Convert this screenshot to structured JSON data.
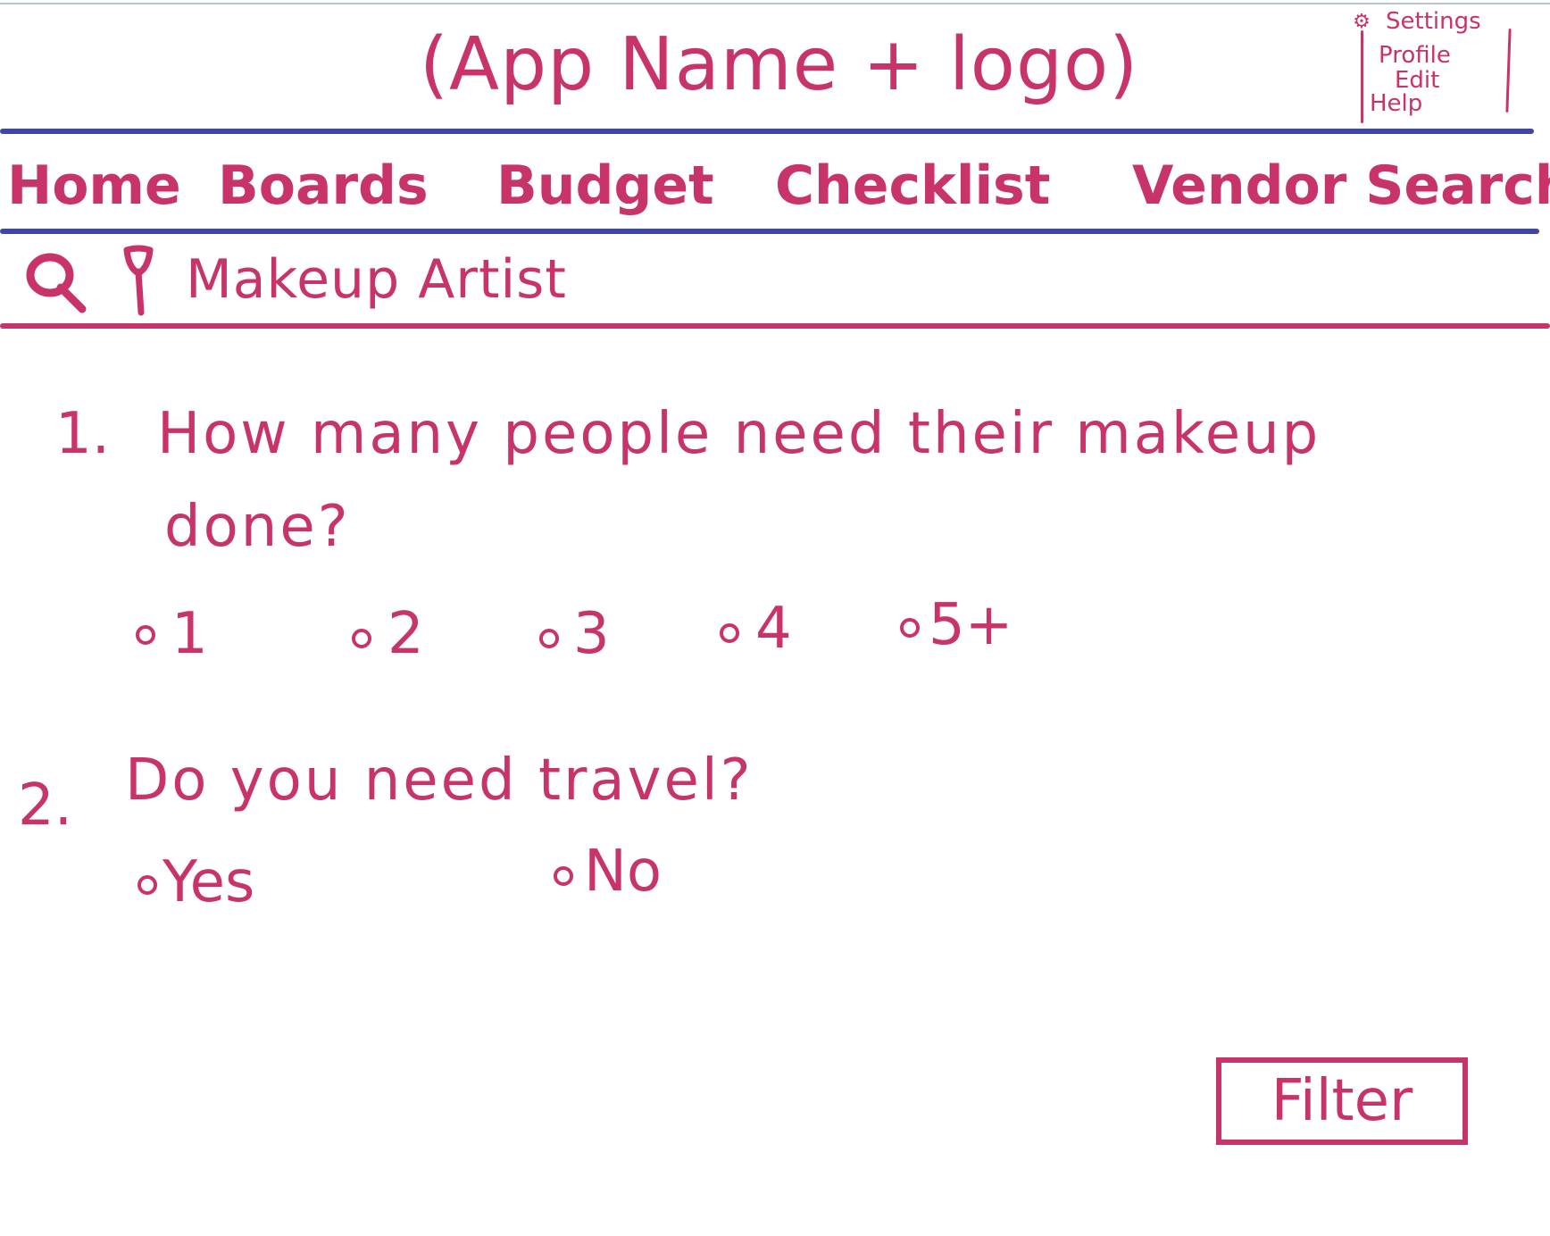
{
  "header": {
    "app_title": "(App Name + logo)",
    "settings_menu": {
      "icon": "gear-icon",
      "items": [
        "Settings",
        "Profile",
        "Edit",
        "Help"
      ]
    }
  },
  "nav": {
    "items": [
      "Home",
      "Boards",
      "Budget",
      "Checklist",
      "Vendor Search"
    ]
  },
  "search": {
    "search_icon": "search-icon",
    "location_icon": "location-pin-icon",
    "value": "Makeup Artist"
  },
  "questions": [
    {
      "number": "1.",
      "text_line1": "How many people need their makeup",
      "text_line2": "done?",
      "options": [
        "1",
        "2",
        "3",
        "4",
        "5+"
      ]
    },
    {
      "number": "2.",
      "text_line1": "Do you need travel?",
      "options": [
        "Yes",
        "No"
      ]
    }
  ],
  "filter_button": {
    "label": "Filter"
  },
  "colors": {
    "ink_pink": "#c8336a",
    "rule_blue": "#4146a0"
  }
}
